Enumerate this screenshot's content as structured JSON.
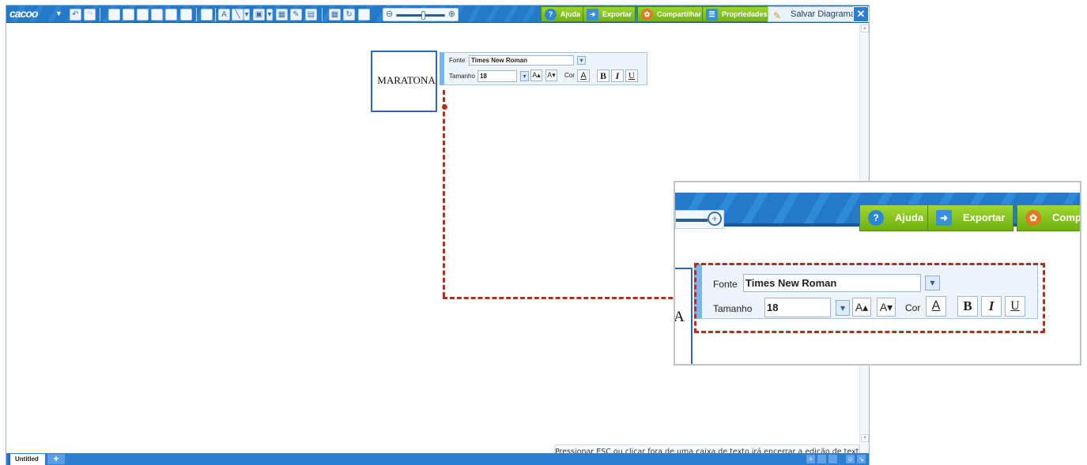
{
  "app": {
    "logo": "cacoo"
  },
  "toolbar": {
    "help_label": "Ajuda",
    "export_label": "Exportar",
    "share_label": "Compartilhar",
    "properties_label": "Propriedades",
    "save_label": "Salvar Diagrama",
    "close_label": "✕"
  },
  "canvas": {
    "shape_label": "MARATONA"
  },
  "font_panel": {
    "font_label": "Fonte",
    "font_value": "Times New Roman",
    "size_label": "Tamanho",
    "size_value": "18",
    "color_label": "Cor",
    "color_btn": "A",
    "bold_btn": "B",
    "italic_btn": "I",
    "underline_btn": "U"
  },
  "status": {
    "message": "Pressionar ESC ou clicar fora de uma caixa de texto irá encerrar a edição de texto."
  },
  "bottom": {
    "tab_label": "Untitled",
    "add_tab": "+"
  },
  "inset": {
    "help_label": "Ajuda",
    "export_label": "Exportar",
    "share_label": "Comp",
    "shape_fragment": "A"
  },
  "colors": {
    "toolbar_blue": "#2479c9",
    "green_button": "#7fc01c",
    "highlight_dashed": "#a8331f",
    "shape_border": "#3366aa"
  },
  "icons": [
    "menu-caret-icon",
    "undo-icon",
    "redo-icon",
    "zoom-out-icon",
    "zoom-in-icon",
    "help-icon",
    "export-icon",
    "share-icon",
    "properties-icon",
    "save-icon",
    "close-icon",
    "add-tab-icon"
  ]
}
